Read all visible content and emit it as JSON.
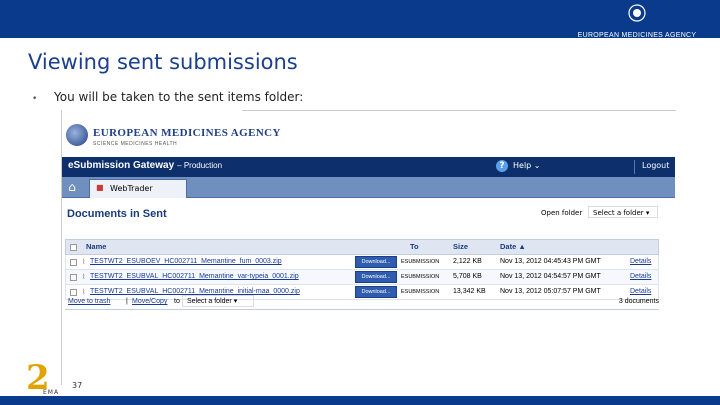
{
  "slide": {
    "title": "Viewing sent submissions",
    "bullet": "You will be taken to the sent items folder:",
    "page_number": "37",
    "header_logo_text": "EUROPEAN MEDICINES AGENCY",
    "anniversary": {
      "number": "2",
      "label": "EMA"
    }
  },
  "colors": {
    "brand_blue": "#0a3a8c",
    "app_bar": "#0d2f6b",
    "tab_bar": "#6f8fbf",
    "title_blue": "#1b3f8f",
    "anniv_gold": "#e0a400"
  },
  "app": {
    "brand_name": "EUROPEAN MEDICINES AGENCY",
    "brand_tagline": "SCIENCE  MEDICINES  HEALTH",
    "title": "eSubmission Gateway",
    "environment": "– Production",
    "help": "Help ⌄",
    "logout": "Logout",
    "tab_label": "WebTrader",
    "page_heading": "Documents in Sent",
    "open_folder_label": "Open folder",
    "folder_select": "Select a folder",
    "columns": {
      "name": "Name",
      "to": "To",
      "size": "Size",
      "date": "Date ▲"
    },
    "rows": [
      {
        "name": "TESTWT2_ESUBOEV_HC002711_Memantine_fum_0003.zip",
        "download": "Download...",
        "to": "ESUBMISSION",
        "size": "2,122 KB",
        "date": "Nov 13, 2012 04:45:43 PM GMT",
        "details": "Details"
      },
      {
        "name": "TESTWT2_ESUBVAL_HC002711_Memantine_var-typeia_0001.zip",
        "download": "Download...",
        "to": "ESUBMISSION",
        "size": "5,708 KB",
        "date": "Nov 13, 2012 04:54:57 PM GMT",
        "details": "Details"
      },
      {
        "name": "TESTWT2_ESUBVAL_HC002711_Memantine_initial-maa_0000.zip",
        "download": "Download...",
        "to": "ESUBMISSION",
        "size": "13,342 KB",
        "date": "Nov 13, 2012 05:07:57 PM GMT",
        "details": "Details"
      }
    ],
    "actions": {
      "move_to_trash": "Move to trash",
      "move_copy": "Move/Copy",
      "to": "to",
      "select_folder": "Select a folder",
      "count": "3 documents"
    }
  }
}
